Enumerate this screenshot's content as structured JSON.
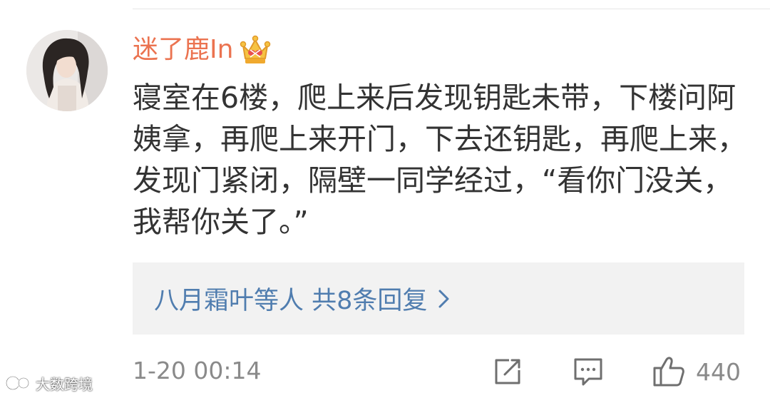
{
  "comment": {
    "username": "迷了鹿In",
    "badge_icon": "crown-badge-icon",
    "text": "寝室在6楼，爬上来后发现钥匙未带，下楼问阿姨拿，再爬上来开门，下去还钥匙，再爬上来，发现门紧闭，隔壁一同学经过，“看你门没关，我帮你关了。”",
    "replies_label": "八月霜叶等人 共8条回复",
    "timestamp": "1-20 00:14",
    "like_count": "440"
  },
  "colors": {
    "username": "#eb7350",
    "link": "#507daf",
    "text": "#333333",
    "meta": "#8a8a8a",
    "reply_bg": "#f2f2f2"
  },
  "watermark": {
    "text": "大数跨境"
  }
}
